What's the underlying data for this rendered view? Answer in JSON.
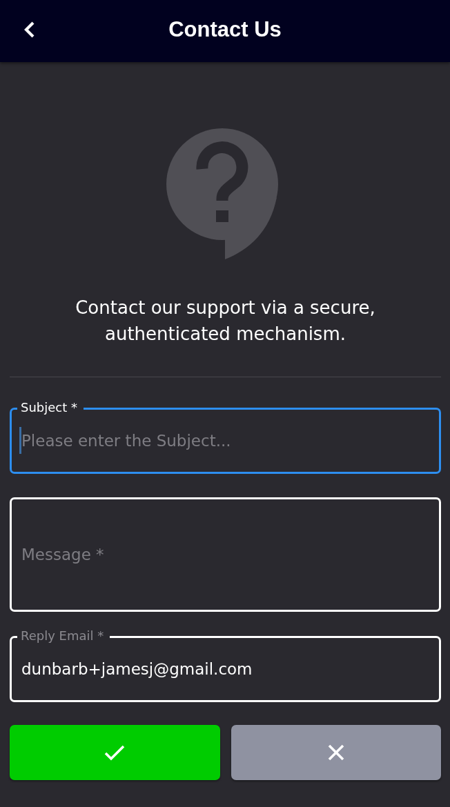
{
  "top_bar": {
    "title": "Contact Us"
  },
  "intro": "Contact our support via a secure, authenticated mechanism.",
  "fields": [
    {
      "kind": "single",
      "label": "Subject *",
      "placeholder": "Please enter the Subject...",
      "focused": true
    },
    {
      "kind": "multi",
      "placeholder": "Message *",
      "focused": false
    },
    {
      "kind": "single",
      "label": "Reply Email *",
      "value": "dunbarb+jamesj@gmail.com",
      "focused": false
    }
  ],
  "buttons": [
    {
      "kind": "confirm"
    },
    {
      "kind": "cancel"
    }
  ]
}
